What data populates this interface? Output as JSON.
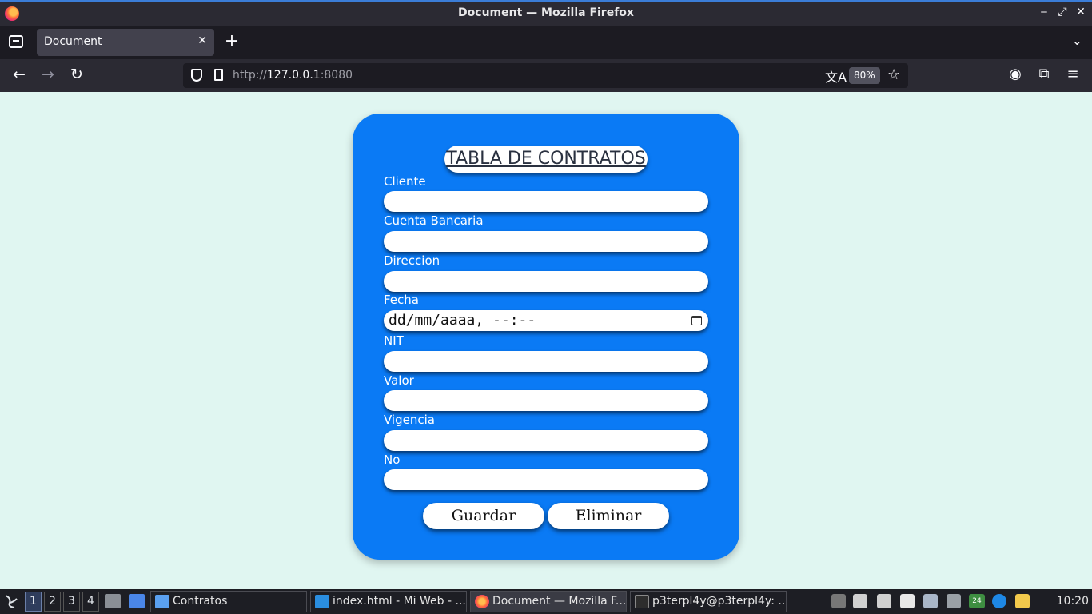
{
  "window": {
    "title": "Document — Mozilla Firefox",
    "controls": {
      "minimize": "‒",
      "maximize": "⤢",
      "close": "✕"
    }
  },
  "tabs": [
    {
      "label": "Document",
      "close": "✕"
    }
  ],
  "tabstrip": {
    "new_tab": "+",
    "list_all": "⌄"
  },
  "nav": {
    "back": "←",
    "forward": "→",
    "reload": "↻",
    "url_scheme": "http://",
    "url_host": "127.0.0.1",
    "url_port": ":8080",
    "translate": "文A",
    "zoom": "80%",
    "bookmark": "☆",
    "account": "◉",
    "extensions": "⧉",
    "menu": "≡"
  },
  "form": {
    "title": "TABLA DE CONTRATOS",
    "fields": [
      {
        "label": "Cliente",
        "value": ""
      },
      {
        "label": "Cuenta Bancaria",
        "value": ""
      },
      {
        "label": "Direccion",
        "value": ""
      },
      {
        "label": "Fecha",
        "value": "dd/mm/aaaa, --:--"
      },
      {
        "label": "NIT",
        "value": ""
      },
      {
        "label": "Valor",
        "value": ""
      },
      {
        "label": "Vigencia",
        "value": ""
      },
      {
        "label": "No",
        "value": ""
      }
    ],
    "save_label": "Guardar",
    "delete_label": "Eliminar"
  },
  "taskbar": {
    "workspaces": [
      "1",
      "2",
      "3",
      "4"
    ],
    "tasks": [
      {
        "label": "Contratos"
      },
      {
        "label": "index.html - Mi Web - ..."
      },
      {
        "label": "Document — Mozilla F..."
      },
      {
        "label": "p3terpl4y@p3terpl4y: ..."
      }
    ],
    "battery_text": "24",
    "clock": "10:20"
  },
  "colors": {
    "page_bg": "#e0f6f1",
    "card_bg": "#0a7af5",
    "label_text": "#ffffff"
  }
}
